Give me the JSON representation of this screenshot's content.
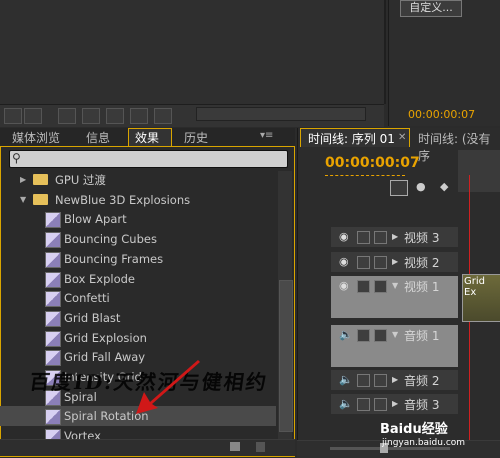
{
  "monitor": {
    "custom_label": "自定义...",
    "timecode": "00:00:00:07"
  },
  "effects": {
    "tabs": [
      "媒体浏览",
      "信息",
      "效果",
      "历史"
    ],
    "search_placeholder": "",
    "tree": [
      {
        "label": "GPU 过渡",
        "kind": "folder",
        "expanded": false
      },
      {
        "label": "NewBlue 3D Explosions",
        "kind": "folder",
        "expanded": true
      },
      {
        "label": "Blow Apart",
        "kind": "effect"
      },
      {
        "label": "Bouncing Cubes",
        "kind": "effect"
      },
      {
        "label": "Bouncing Frames",
        "kind": "effect"
      },
      {
        "label": "Box Explode",
        "kind": "effect"
      },
      {
        "label": "Confetti",
        "kind": "effect"
      },
      {
        "label": "Grid Blast",
        "kind": "effect"
      },
      {
        "label": "Grid Explosion",
        "kind": "effect"
      },
      {
        "label": "Grid Fall Away",
        "kind": "effect"
      },
      {
        "label": "Intensity Grid",
        "kind": "effect"
      },
      {
        "label": "Spiral",
        "kind": "effect"
      },
      {
        "label": "Spiral Rotation",
        "kind": "effect",
        "selected": true
      },
      {
        "label": "Vortex",
        "kind": "effect"
      }
    ]
  },
  "timeline": {
    "tab_active": "时间线: 序列 01",
    "tab_other": "时间线: (没有序",
    "timecode": "00:00:00:07",
    "tracks": [
      {
        "name": "视频 3"
      },
      {
        "name": "视频 2"
      },
      {
        "name": "视频 1",
        "clip": "Grid Ex"
      },
      {
        "name": "音频 1"
      },
      {
        "name": "音频 2"
      },
      {
        "name": "音频 3"
      }
    ]
  },
  "watermark": {
    "text": "百度ID:天然河与健相约",
    "brand": "Baidu经验",
    "url": "jingyan.baidu.com"
  },
  "colors": {
    "accent": "#d9a500",
    "timecode": "#e9a300",
    "playhead": "#d02020"
  }
}
